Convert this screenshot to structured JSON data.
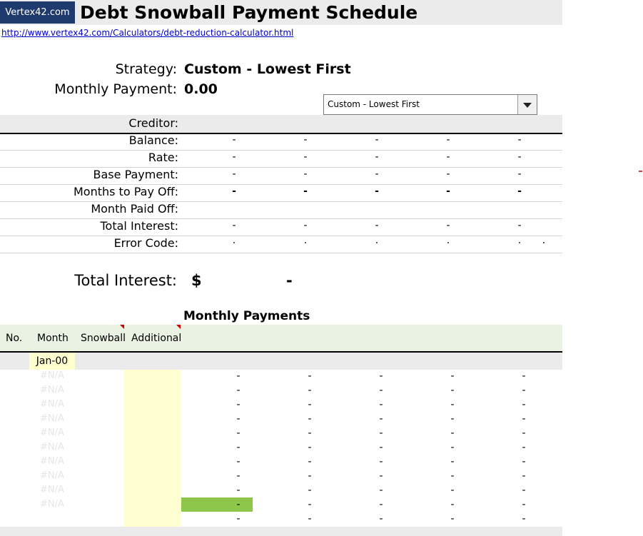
{
  "header": {
    "logo": "Vertex42.com",
    "title": "Debt Snowball Payment Schedule",
    "link": "http://www.vertex42.com/Calculators/debt-reduction-calculator.html"
  },
  "summary": {
    "strategy_label": "Strategy:",
    "strategy_value": "Custom - Lowest First",
    "monthly_payment_label": "Monthly Payment:",
    "monthly_payment_value": "0.00",
    "dropdown_selected": "Custom - Lowest First"
  },
  "creditor_table": {
    "rows": [
      {
        "label": "Creditor:",
        "values": [
          "",
          "",
          "",
          "",
          ""
        ]
      },
      {
        "label": "Balance:",
        "values": [
          "-",
          "-",
          "-",
          "-",
          "-"
        ]
      },
      {
        "label": "Rate:",
        "values": [
          "-",
          "-",
          "-",
          "-",
          "-"
        ]
      },
      {
        "label": "Base Payment:",
        "values": [
          "-",
          "-",
          "-",
          "-",
          "-"
        ]
      },
      {
        "label": "Months to Pay Off:",
        "values": [
          "-",
          "-",
          "-",
          "-",
          "-"
        ]
      },
      {
        "label": "Month Paid Off:",
        "values": [
          "",
          "",
          "",
          "",
          ""
        ]
      },
      {
        "label": "Total Interest:",
        "values": [
          "-",
          "-",
          "-",
          "-",
          "-"
        ]
      },
      {
        "label": "Error Code:",
        "values": [
          ".",
          ".",
          ".",
          ".",
          ".",
          "."
        ]
      }
    ]
  },
  "total_interest": {
    "label": "Total Interest:",
    "currency": "$",
    "value": "-"
  },
  "monthly_payments": {
    "title": "Monthly Payments",
    "headers": [
      "No.",
      "Month",
      "Snowball",
      "Additional"
    ],
    "first_month": "Jan-00",
    "na_text": "#N/A",
    "dash": "-"
  }
}
